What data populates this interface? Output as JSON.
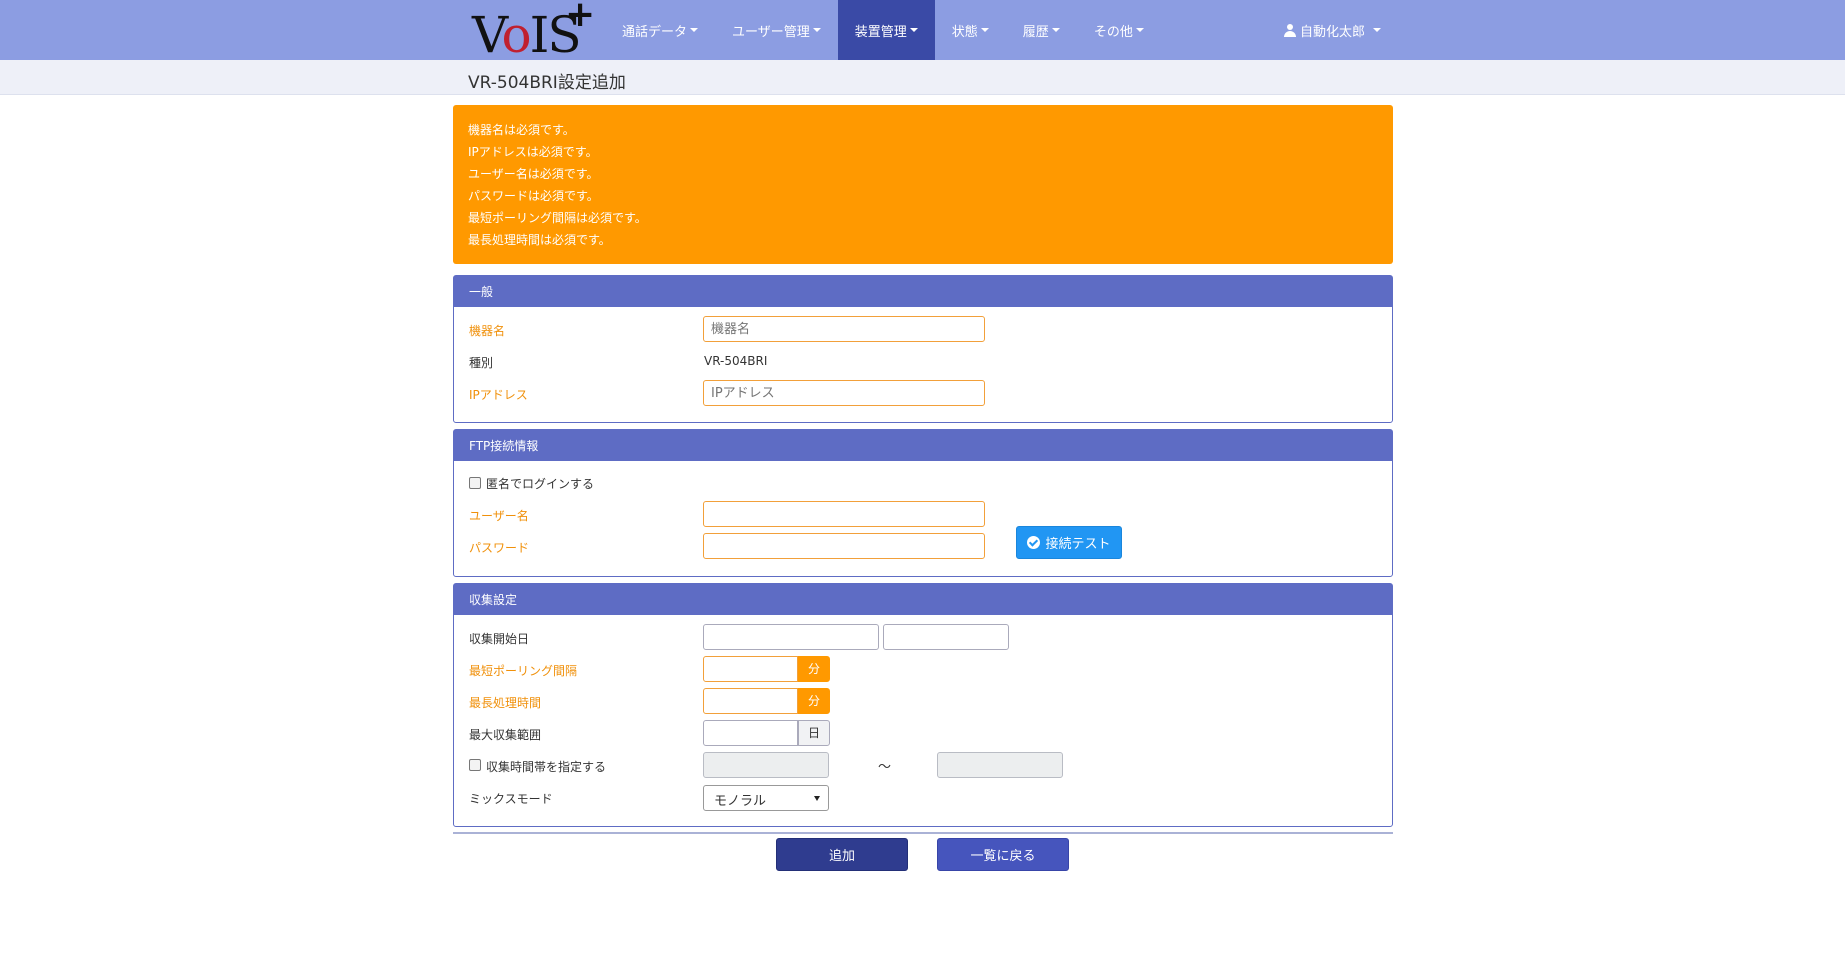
{
  "header": {
    "logo_text": "VoIS+",
    "nav": [
      {
        "label": "通話データ"
      },
      {
        "label": "ユーザー管理"
      },
      {
        "label": "装置管理"
      },
      {
        "label": "状態"
      },
      {
        "label": "履歴"
      },
      {
        "label": "その他"
      }
    ],
    "active_nav": "装置管理",
    "user_name": "自動化太郎"
  },
  "page_title": "VR-504BRI設定追加",
  "alert": {
    "messages": [
      "機器名は必須です。",
      "IPアドレスは必須です。",
      "ユーザー名は必須です。",
      "パスワードは必須です。",
      "最短ポーリング間隔は必須です。",
      "最長処理時間は必須です。"
    ]
  },
  "general": {
    "heading": "一般",
    "device_name_label": "機器名",
    "device_name_placeholder": "機器名",
    "type_label": "種別",
    "type_value": "VR-504BRI",
    "ip_label": "IPアドレス",
    "ip_placeholder": "IPアドレス"
  },
  "ftp": {
    "heading": "FTP接続情報",
    "anonymous_label": "匿名でログインする",
    "username_label": "ユーザー名",
    "password_label": "パスワード",
    "test_button": "接続テスト"
  },
  "collection": {
    "heading": "収集設定",
    "start_date_label": "収集開始日",
    "min_polling_label": "最短ポーリング間隔",
    "min_polling_unit": "分",
    "max_processing_label": "最長処理時間",
    "max_processing_unit": "分",
    "max_range_label": "最大収集範囲",
    "max_range_unit": "日",
    "time_range_label": "収集時間帯を指定する",
    "tilde": "～",
    "mix_mode_label": "ミックスモード",
    "mix_mode_value": "モノラル"
  },
  "actions": {
    "add": "追加",
    "back": "一覧に戻る"
  },
  "colors": {
    "navbar": "#8c9de2",
    "active_nav": "#3a4aa6",
    "alert": "#ff9900",
    "panel_heading": "#5e6cc4",
    "required": "#f0900a",
    "test_button": "#2196f3"
  }
}
